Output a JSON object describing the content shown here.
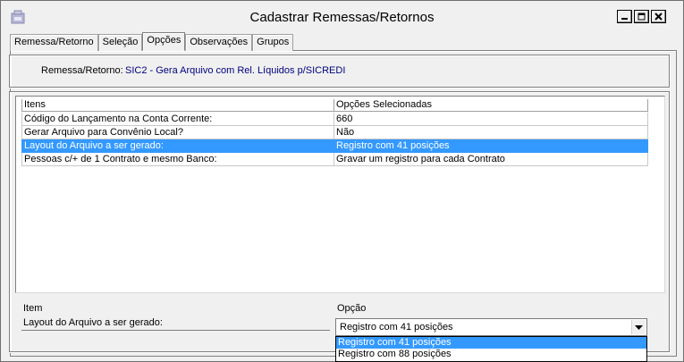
{
  "window": {
    "title": "Cadastrar Remessas/Retornos"
  },
  "tabs": [
    {
      "label": "Remessa/Retorno"
    },
    {
      "label": "Seleção"
    },
    {
      "label": "Opções"
    },
    {
      "label": "Observações"
    },
    {
      "label": "Grupos"
    }
  ],
  "remessa": {
    "label": "Remessa/Retorno:",
    "value": "SIC2 - Gera Arquivo com Rel. Líquidos p/SICREDI"
  },
  "grid": {
    "headers": [
      "Itens",
      "Opções Selecionadas"
    ],
    "rows": [
      {
        "item": "Código do Lançamento na Conta Corrente:",
        "option": "660"
      },
      {
        "item": "Gerar Arquivo para Convênio Local?",
        "option": "Não"
      },
      {
        "item": "Layout do Arquivo a ser gerado:",
        "option": "Registro com 41 posições"
      },
      {
        "item": "Pessoas c/+ de 1 Contrato e mesmo Banco:",
        "option": "Gravar um registro para cada Contrato"
      }
    ]
  },
  "editor": {
    "item_label": "Item",
    "opcao_label": "Opção",
    "item_value": "Layout do Arquivo a ser gerado:",
    "select_value": "Registro com 41 posições",
    "options": [
      "Registro com 41 posições",
      "Registro com 88 posições"
    ]
  },
  "colors": {
    "selection": "#3399ff",
    "remessa_value": "#00007f"
  }
}
